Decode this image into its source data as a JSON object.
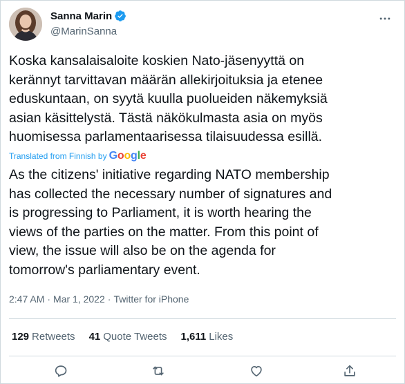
{
  "author": {
    "display_name": "Sanna Marin",
    "handle": "@MarinSanna",
    "avatar_icon": "profile-photo",
    "verified_icon": "verified-badge-icon",
    "verified_color": "#1d9bf0"
  },
  "tweet": {
    "text_fi": "Koska kansalaisaloite koskien Nato-jäsenyyttä on\nkerännyt tarvittavan määrän allekirjoituksia ja etenee\neduskuntaan, on syytä kuulla puolueiden näkemyksiä\nasian käsittelystä. Tästä näkökulmasta asia on myös\nhuomisessa parlamentaarisessa tilaisuudessa esillä.",
    "translated_label": "Translated from Finnish by",
    "google_logo": {
      "G": "G",
      "o1": "o",
      "o2": "o",
      "g": "g",
      "l": "l",
      "e": "e"
    },
    "text_en": "As the citizens' initiative regarding NATO membership\nhas collected the necessary number of signatures and\nis progressing to Parliament, it is worth hearing the\nviews of the parties on the matter. From this point of\nview, the issue will also be on the agenda for\ntomorrow's parliamentary event.",
    "time": "2:47 AM",
    "separator": "·",
    "date": "Mar 1, 2022",
    "source": "Twitter for iPhone"
  },
  "stats": {
    "retweets_count": "129",
    "retweets_label": "Retweets",
    "quotes_count": "41",
    "quotes_label": "Quote Tweets",
    "likes_count": "1,611",
    "likes_label": "Likes"
  },
  "actions": [
    "reply-icon",
    "retweet-icon",
    "like-icon",
    "share-icon"
  ],
  "colors": {
    "text": "#0f1419",
    "secondary": "#536471",
    "accent": "#1d9bf0",
    "divider": "#cfd9de"
  }
}
